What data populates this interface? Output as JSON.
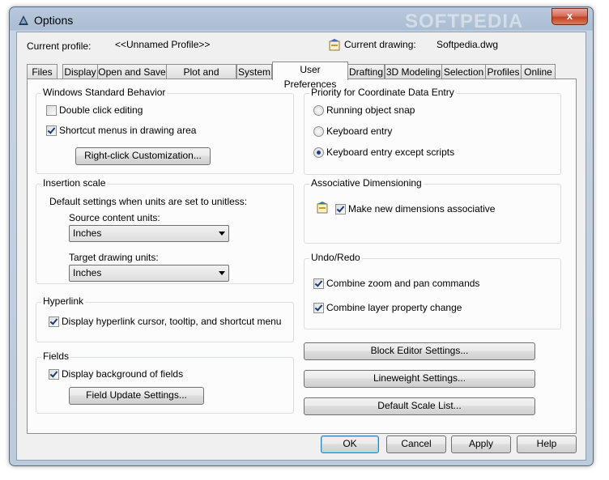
{
  "window": {
    "title": "Options",
    "close_label": "x",
    "watermark": "SOFTPEDIA"
  },
  "profile": {
    "current_profile_label": "Current profile:",
    "current_profile_value": "<<Unnamed Profile>>",
    "current_drawing_label": "Current drawing:",
    "current_drawing_value": "Softpedia.dwg"
  },
  "tabs": [
    {
      "label": "Files"
    },
    {
      "label": "Display"
    },
    {
      "label": "Open and Save"
    },
    {
      "label": "Plot and Publish"
    },
    {
      "label": "System"
    },
    {
      "label": "User Preferences",
      "active": true
    },
    {
      "label": "Drafting"
    },
    {
      "label": "3D Modeling"
    },
    {
      "label": "Selection"
    },
    {
      "label": "Profiles"
    },
    {
      "label": "Online"
    }
  ],
  "windows_behavior": {
    "title": "Windows Standard Behavior",
    "double_click": {
      "label": "Double click editing",
      "checked": false
    },
    "shortcut_menus": {
      "label": "Shortcut menus in drawing area",
      "checked": true
    },
    "right_click_button": "Right-click Customization..."
  },
  "insertion_scale": {
    "title": "Insertion scale",
    "description": "Default settings when units are set to unitless:",
    "source_label": "Source content units:",
    "source_value": "Inches",
    "target_label": "Target drawing units:",
    "target_value": "Inches"
  },
  "hyperlink": {
    "title": "Hyperlink",
    "display": {
      "label": "Display hyperlink cursor, tooltip, and shortcut menu",
      "checked": true
    }
  },
  "fields": {
    "title": "Fields",
    "background": {
      "label": "Display background of fields",
      "checked": true
    },
    "update_button": "Field Update Settings..."
  },
  "coordinate_priority": {
    "title": "Priority for Coordinate Data Entry",
    "options": [
      {
        "label": "Running object snap",
        "selected": false
      },
      {
        "label": "Keyboard entry",
        "selected": false
      },
      {
        "label": "Keyboard entry except scripts",
        "selected": true
      }
    ]
  },
  "associative_dim": {
    "title": "Associative Dimensioning",
    "make_associative": {
      "label": "Make new dimensions associative",
      "checked": true
    }
  },
  "undo_redo": {
    "title": "Undo/Redo",
    "combine_zoom": {
      "label": "Combine zoom and pan commands",
      "checked": true
    },
    "combine_layer": {
      "label": "Combine layer property change",
      "checked": true
    }
  },
  "right_buttons": {
    "block_editor": "Block Editor Settings...",
    "lineweight": "Lineweight Settings...",
    "scale_list": "Default Scale List..."
  },
  "footer": {
    "ok": "OK",
    "cancel": "Cancel",
    "apply": "Apply",
    "help": "Help"
  },
  "colors": {
    "title_bar": "#b9c9dc",
    "panel": "#fcfcfc",
    "dialog": "#f0f0f0",
    "accent_border": "#3c7fb1"
  }
}
